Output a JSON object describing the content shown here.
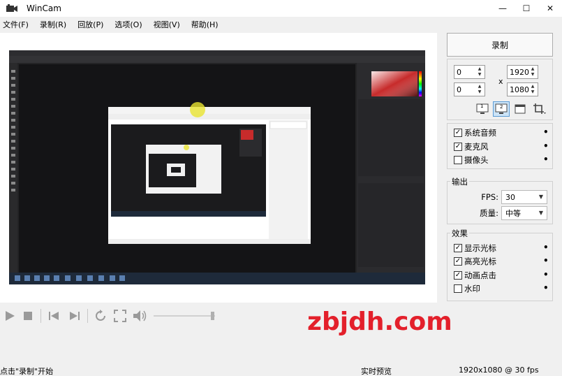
{
  "window": {
    "title": "WinCam",
    "minimize": "—",
    "maximize": "☐",
    "close": "✕"
  },
  "menu": [
    {
      "label": "文件(F)"
    },
    {
      "label": "录制(R)"
    },
    {
      "label": "回放(P)"
    },
    {
      "label": "选项(O)"
    },
    {
      "label": "视图(V)"
    },
    {
      "label": "帮助(H)"
    }
  ],
  "record": {
    "label": "录制"
  },
  "region": {
    "x": "0",
    "y": "0",
    "width": "1920",
    "height": "1080",
    "times": "x"
  },
  "modes": {
    "one": "1",
    "two": "2"
  },
  "sources": [
    {
      "label": "系统音频",
      "checked": true
    },
    {
      "label": "麦克风",
      "checked": true
    },
    {
      "label": "摄像头",
      "checked": false
    }
  ],
  "output": {
    "title": "输出",
    "fps_label": "FPS:",
    "fps_value": "30",
    "quality_label": "质量:",
    "quality_value": "中等"
  },
  "effects": {
    "title": "效果",
    "items": [
      {
        "label": "显示光标",
        "checked": true
      },
      {
        "label": "高亮光标",
        "checked": true
      },
      {
        "label": "动画点击",
        "checked": true
      },
      {
        "label": "水印",
        "checked": false
      }
    ]
  },
  "status": {
    "left": "点击\"录制\"开始",
    "mid": "实时预览",
    "right": "1920x1080 @ 30 fps"
  },
  "watermark": "zbjdh.com",
  "colors": {
    "record_hl": "#cce4f7",
    "watermark": "#e3202b"
  }
}
